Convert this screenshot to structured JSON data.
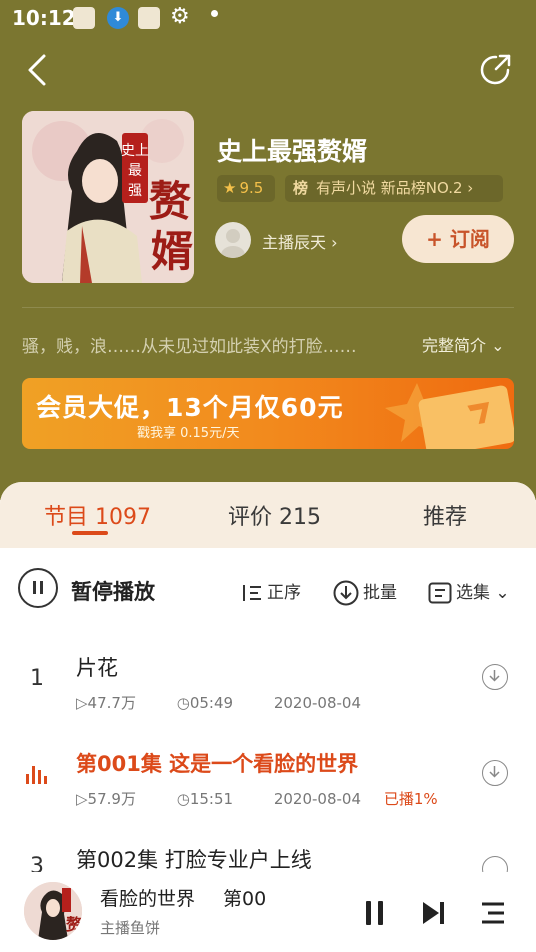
{
  "status": {
    "time": "10:12"
  },
  "book": {
    "title": "史上最强赘婿",
    "rating": "9.5",
    "rank_badge": "榜",
    "rank_text": "有声小说 新品榜NO.2",
    "host_label": "主播辰天",
    "subscribe_label": "+ 订阅",
    "intro": "骚，贱，浪……从未见过如此装X的打脸……",
    "intro_toggle": "完整简介",
    "cover_title": "史上最强赘婿"
  },
  "banner": {
    "title": "会员大促，13个月仅60元",
    "subtitle": "戳我享 0.15元/天"
  },
  "tabs": [
    {
      "label": "节目",
      "count": "1097"
    },
    {
      "label": "评价",
      "count": "215"
    },
    {
      "label": "推荐",
      "count": ""
    }
  ],
  "controls": {
    "play_label": "暂停播放",
    "order_label": "正序",
    "batch_label": "批量",
    "select_label": "选集"
  },
  "episodes": [
    {
      "num": "1",
      "title": "片花",
      "plays": "47.7万",
      "duration": "05:49",
      "date": "2020-08-04",
      "progress": ""
    },
    {
      "num": "",
      "title": "第001集 这是一个看脸的世界",
      "plays": "57.9万",
      "duration": "15:51",
      "date": "2020-08-04",
      "progress": "已播1%"
    },
    {
      "num": "3",
      "title": "第002集 打脸专业户上线",
      "plays": "",
      "duration": "",
      "date": "",
      "progress": ""
    }
  ],
  "player": {
    "title": "看脸的世界",
    "title_next": "第00",
    "host": "主播鱼饼"
  },
  "colors": {
    "accent": "#dc4a1a",
    "hero_bg": "#7b7630",
    "sheet_bg": "#f7ede0"
  }
}
